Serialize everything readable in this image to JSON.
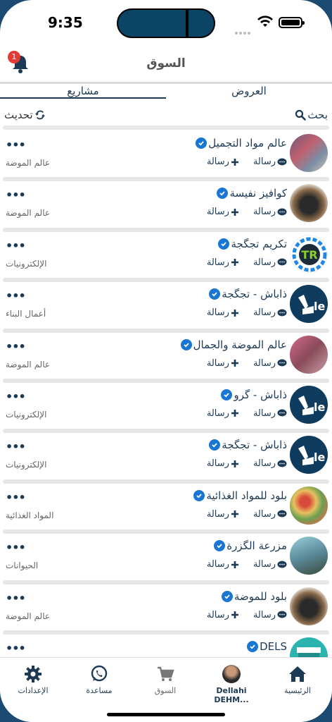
{
  "status": {
    "time": "9:35"
  },
  "header": {
    "title": "السوق",
    "notification_count": "1"
  },
  "tabs": [
    {
      "label": "مشاريع",
      "active": true
    },
    {
      "label": "العروض",
      "active": false
    }
  ],
  "toolbar": {
    "refresh_label": "تحديث",
    "search_label": "بحث"
  },
  "item_actions": {
    "message_label": "رسالة",
    "add_label": "رسالة"
  },
  "items": [
    {
      "name": "عالم مواد التجميل",
      "category": "عالم الموضة"
    },
    {
      "name": "كوافيز نفيسة",
      "category": "عالم الموضة"
    },
    {
      "name": "تكريم تجگجة",
      "category": "الإلكترونيات"
    },
    {
      "name": "ذاباش - تجگجة",
      "category": "أعمال البناء"
    },
    {
      "name": "عالم الموضة والجمال",
      "category": "عالم الموضة"
    },
    {
      "name": "ذاباش - گرو",
      "category": "الإلكترونيات"
    },
    {
      "name": "ذاباش - تجگجة",
      "category": "الإلكترونيات"
    },
    {
      "name": "بلود للمواد الغذائية",
      "category": "المواد الغذائية"
    },
    {
      "name": "مزرعة الگزرة",
      "category": "الحيوانات"
    },
    {
      "name": "بلود للموضة",
      "category": "عالم الموضة"
    },
    {
      "name": "DELS",
      "category": ""
    }
  ],
  "tabbar": {
    "settings": "الإعدادات",
    "help": "مساعدة",
    "market": "السوق",
    "profile": "Dellahi DEHM...",
    "home": "الرئيسية"
  },
  "colors": {
    "primary": "#1d3a55",
    "accent": "#1976d2",
    "badge": "#e53935"
  }
}
